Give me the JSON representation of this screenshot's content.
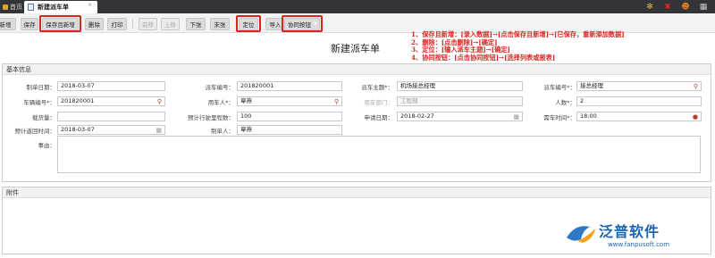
{
  "topbar": {
    "home_label": "首页",
    "tab_title": "新建派车单",
    "tab_close": "×"
  },
  "toolbar": {
    "buttons": [
      "新增",
      "保存",
      "保存且新增",
      "删除",
      "打印",
      "前移",
      "上移",
      "下张",
      "末张",
      "定位",
      "导入",
      "协同按钮"
    ],
    "collab_arrow": "▼"
  },
  "form_title": "新建派车单",
  "annotations": [
    "1、保存且新增：[录入数据]→[点击保存且新增]→[已保存，重新添加数据]",
    "2、删除：[点击删除]→[确定]",
    "3、定位：[输入派车主题]→[确定]",
    "4、协同按钮：[点击协同按钮]→[选择列表或报表]"
  ],
  "section": {
    "basic_info": "基本信息",
    "attachments": "附件"
  },
  "fields": {
    "make_date_label": "制单日期：",
    "make_date": "2018-03-07",
    "dispatch_no_label": "派车编号：",
    "dispatch_no": "201820001",
    "subject_label": "派车主题*：",
    "subject": "机场接总经理",
    "apply_no_label": "派车编号*：",
    "apply_no": "接总经理",
    "vehicle_no_label": "车辆编号*：",
    "vehicle_no": "201820001",
    "user_label": "用车人*：",
    "user": "章燕",
    "dept_label": "用车部门：",
    "dept": "工程部",
    "people_label": "人数*：",
    "people": "2",
    "load_label": "载货量：",
    "load": "",
    "mileage_label": "预计行驶里程数：",
    "mileage": "100",
    "apply_date_label": "申请日期：",
    "apply_date": "2018-02-27",
    "use_time_label": "需车时间*：",
    "use_time": "18:00",
    "return_label": "预计返回时间：",
    "return_time": "2018-03-07",
    "maker_label": "制单人：",
    "maker": "章燕",
    "reason_label": "事由："
  },
  "brand": {
    "name": "泛普软件",
    "url": "www.fanpusoft.com"
  },
  "colors": {
    "highlight": "#d9241f",
    "brand": "#1d64b0"
  }
}
